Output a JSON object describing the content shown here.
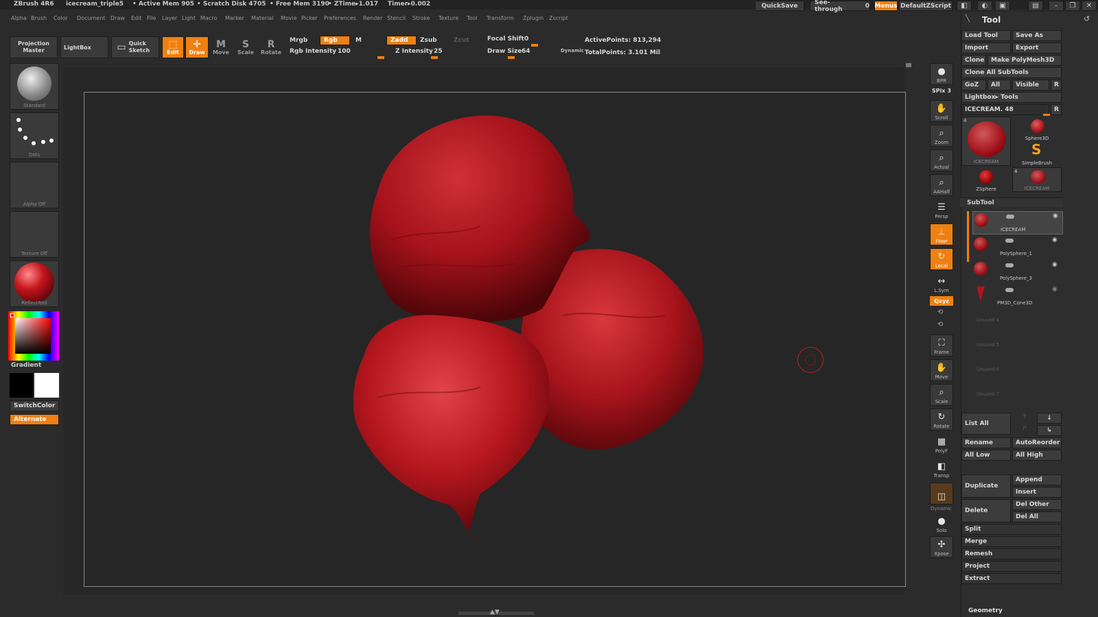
{
  "titlebar": {
    "app": "ZBrush 4R6",
    "document": "icecream_triple5",
    "active_mem": "• Active Mem 905",
    "scratch": "• Scratch Disk 4705",
    "free_mem": "• Free Mem 3190",
    "ztime": "• ZTime▸1.017",
    "timer": "Timer▸0.002",
    "quicksave": "QuickSave",
    "seethrough": "See-through",
    "seethrough_value": "0",
    "menus": "Menus",
    "defaultzscript": "DefaultZScript"
  },
  "menu": [
    "Alpha",
    "Brush",
    "Color",
    "Document",
    "Draw",
    "Edit",
    "File",
    "Layer",
    "Light",
    "Macro",
    "Marker",
    "Material",
    "Movie",
    "Picker",
    "Preferences",
    "Render",
    "Stencil",
    "Stroke",
    "Texture",
    "Tool",
    "Transform",
    "Zplugin",
    "Zscript"
  ],
  "toolbar": {
    "projection_master": "Projection Master",
    "lightbox": "LightBox",
    "quick_sketch": "Quick Sketch",
    "edit": "Edit",
    "draw": "Draw",
    "move": "Move",
    "scale": "Scale",
    "rotate": "Rotate",
    "mrgb": "Mrgb",
    "rgb": "Rgb",
    "m": "M",
    "rgb_intensity_label": "Rgb Intensity",
    "rgb_intensity_value": "100",
    "zadd": "Zadd",
    "zsub": "Zsub",
    "zcut": "Zcut",
    "z_intensity_label": "Z Intensity",
    "z_intensity_value": "25",
    "focal_shift_label": "Focal Shift",
    "focal_shift_value": "0",
    "draw_size_label": "Draw Size",
    "draw_size_value": "64",
    "dynamic": "Dynamic",
    "active_points": "ActivePoints: 813,294",
    "total_points": "TotalPoints: 3.101 Mil"
  },
  "leftshelf": {
    "brush": "Standard",
    "stroke": "Dots",
    "alpha": "Alpha Off",
    "texture": "Texture Off",
    "material": "ReflectRed",
    "gradient": "Gradient",
    "switchcolor": "SwitchColor",
    "alternate": "Alternate"
  },
  "righttools": {
    "bpr": "BPR",
    "spix": "SPix 3",
    "scroll": "Scroll",
    "zoom": "Zoom",
    "actual": "Actual",
    "aahalf": "AAHalf",
    "persp": "Persp",
    "floor": "Floor",
    "local": "Local",
    "lsym": "L.Sym",
    "xyz": "Qxyz",
    "frame": "Frame",
    "move": "Move",
    "scale": "Scale",
    "rotate": "Rotate",
    "polyf": "PolyF",
    "transp": "Transp",
    "dynamic": "Dynamic",
    "solo": "Solo",
    "xpose": "Xpose"
  },
  "toolpanel": {
    "title": "Tool",
    "load_tool": "Load Tool",
    "save_as": "Save As",
    "import": "Import",
    "export": "Export",
    "clone": "Clone",
    "make_polymesh": "Make PolyMesh3D",
    "clone_all": "Clone All SubTools",
    "goz": "GoZ",
    "all": "All",
    "visible": "Visible",
    "r": "R",
    "lightbox_tools": "Lightbox▸ Tools",
    "current_tool": "ICECREAM. 48",
    "thumbs": [
      {
        "name": "ICECREAM",
        "badge": "4"
      },
      {
        "name": "Sphere3D",
        "badge": ""
      },
      {
        "name": "SimpleBrush",
        "badge": ""
      },
      {
        "name": "ZSphere",
        "badge": ""
      },
      {
        "name": "ICECREAM",
        "badge": "4"
      }
    ],
    "subtool_title": "SubTool",
    "subtools": [
      "ICECREAM",
      "PolySphere_1",
      "PolySphere_3",
      "PM3D_Cone3D"
    ],
    "unused": [
      "Unused 4",
      "Unused 5",
      "Unused 6",
      "Unused 7"
    ],
    "list_all": "List All",
    "rename": "Rename",
    "autoreorder": "AutoReorder",
    "all_low": "All Low",
    "all_high": "All High",
    "duplicate": "Duplicate",
    "append": "Append",
    "insert": "Insert",
    "delete": "Delete",
    "del_other": "Del Other",
    "del_all": "Del All",
    "split": "Split",
    "merge": "Merge",
    "remesh": "Remesh",
    "project": "Project",
    "extract": "Extract",
    "geometry": "Geometry"
  },
  "colors": {
    "accent": "#ef8011",
    "model_red": "#b0141c",
    "bg": "#2b2b2b"
  }
}
